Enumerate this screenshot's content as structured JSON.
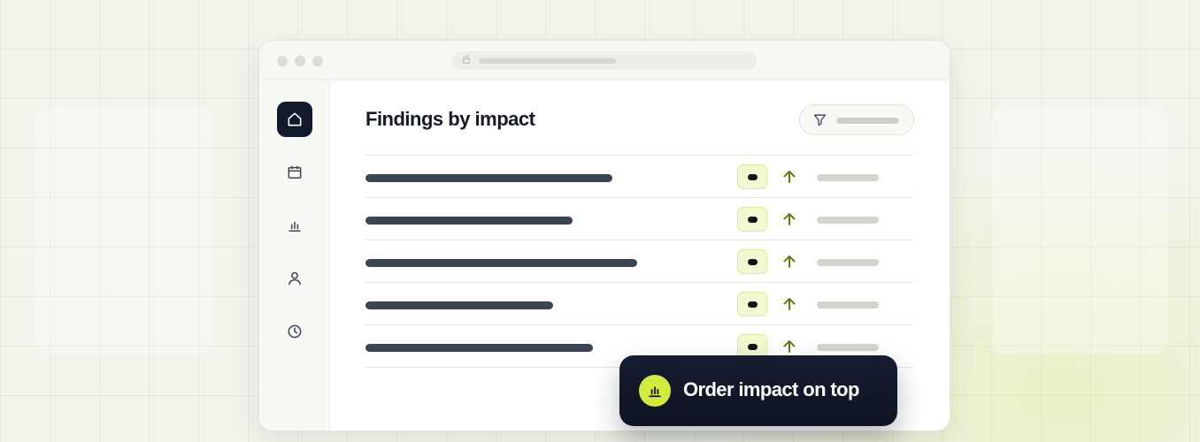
{
  "page": {
    "colors": {
      "background": "#f3f3ec",
      "accent": "#d3ea3f",
      "trend_up": "#5f7d0e",
      "dark": "#121a2c"
    }
  },
  "browser": {
    "controls": [
      "window-dot",
      "window-dot",
      "window-dot"
    ],
    "address_bar_icon": "lock-icon"
  },
  "sidebar": {
    "items": [
      {
        "icon": "home-icon",
        "active": true
      },
      {
        "icon": "calendar-icon",
        "active": false
      },
      {
        "icon": "bar-chart-icon",
        "active": false
      },
      {
        "icon": "user-icon",
        "active": false
      },
      {
        "icon": "clock-icon",
        "active": false
      }
    ]
  },
  "main": {
    "title": "Findings by impact",
    "filter": {
      "icon": "filter-icon"
    },
    "rows": [
      {
        "badge": "impact-badge",
        "trend": "up"
      },
      {
        "badge": "impact-badge",
        "trend": "up"
      },
      {
        "badge": "impact-badge",
        "trend": "up"
      },
      {
        "badge": "impact-badge",
        "trend": "up"
      },
      {
        "badge": "impact-badge",
        "trend": "up"
      }
    ]
  },
  "toast": {
    "icon": "bar-chart-icon",
    "text": "Order impact on top"
  }
}
